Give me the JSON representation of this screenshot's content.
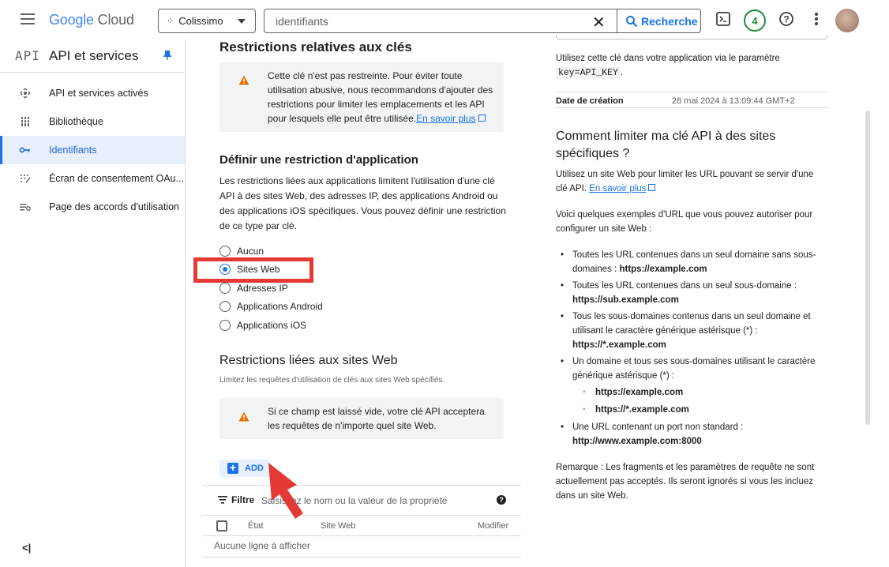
{
  "topbar": {
    "logo_google": "Google",
    "logo_cloud": "Cloud",
    "project": "Colissimo",
    "search_value": "identifiants",
    "search_button": "Recherche",
    "notifications_count": "4"
  },
  "sidebar": {
    "api_badge": "API",
    "title": "API et services",
    "items": [
      {
        "label": "API et services activés",
        "icon": "api-services-icon"
      },
      {
        "label": "Bibliothèque",
        "icon": "library-icon"
      },
      {
        "label": "Identifiants",
        "icon": "key-icon",
        "active": true
      },
      {
        "label": "Écran de consentement OAu...",
        "icon": "consent-screen-icon"
      },
      {
        "label": "Page des accords d'utilisation",
        "icon": "agreements-icon"
      }
    ],
    "collapse_label": "<|"
  },
  "main": {
    "key_restrictions_title": "Restrictions relatives aux clés",
    "key_warning": "Cette clé n'est pas restreinte. Pour éviter toute utilisation abusive, nous recommandons d'ajouter des restrictions pour limiter les emplacements et les API pour lesquels elle peut être utilisée.",
    "learn_more": "En savoir plus",
    "app_restriction_title": "Définir une restriction d'application",
    "app_restriction_desc": "Les restrictions liées aux applications limitent l'utilisation d'une clé API à des sites Web, des adresses IP, des applications Android ou des applications iOS spécifiques. Vous pouvez définir une restriction de ce type par clé.",
    "radio_options": [
      "Aucun",
      "Sites Web",
      "Adresses IP",
      "Applications Android",
      "Applications iOS"
    ],
    "selected_option": "Sites Web",
    "websites_title": "Restrictions liées aux sites Web",
    "websites_hint": "Limitez les requêtes d'utilisation de clés aux sites Web spécifiés.",
    "websites_warning": "Si ce champ est laissé vide, votre clé API acceptera les requêtes de n'importe quel site Web.",
    "add_label": "ADD",
    "filter_label": "Filtre",
    "filter_placeholder": "Saisissez le nom ou la valeur de la propriété",
    "table_columns": [
      "État",
      "Site Web",
      "Modifier"
    ],
    "table_empty": "Aucune ligne à afficher"
  },
  "right": {
    "usage_text_1": "Utilisez cette clé dans votre application via le paramètre",
    "usage_code": "key=API_KEY",
    "usage_text_2": ".",
    "created_label": "Date de création",
    "created_value": "28 mai 2024 à 13:09:44 GMT+2",
    "howto_title": "Comment limiter ma clé API à des sites spécifiques ?",
    "howto_text": "Utilisez un site Web pour limiter les URL pouvant se servir d'une clé API.",
    "learn_more": "En savoir plus",
    "examples_intro": "Voici quelques exemples d'URL que vous pouvez autoriser pour configurer un site Web :",
    "ex1": "Toutes les URL contenues dans un seul domaine sans sous-domaines :",
    "ex1_url": "https://example.com",
    "ex2": "Toutes les URL contenues dans un seul sous-domaine :",
    "ex2_url": "https://sub.example.com",
    "ex3": "Tous les sous-domaines contenus dans un seul domaine et utilisant le caractère générique astérisque (*) :",
    "ex3_url": "https://*.example.com",
    "ex4": "Un domaine et tous ses sous-domaines utilisant le caractère générique astérisque (*) :",
    "ex4_sub1": "https://example.com",
    "ex4_sub2": "https://*.example.com",
    "ex5": "Une URL contenant un port non standard :",
    "ex5_url": "http://www.example.com:8000",
    "note": "Remarque : Les fragments et les paramètres de requête ne sont actuellement pas acceptés. Ils seront ignorés si vous les incluez dans un site Web."
  },
  "colors": {
    "accent": "#1a73e8",
    "highlight_box": "#e53935",
    "warning": "#e37400",
    "active_bg": "#e8f0fe"
  }
}
